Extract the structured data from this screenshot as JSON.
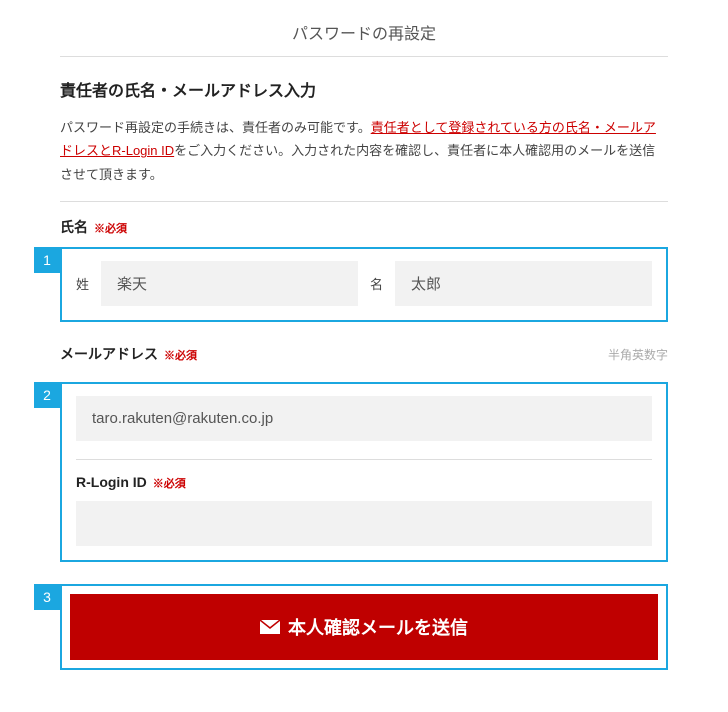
{
  "page": {
    "title": "パスワードの再設定"
  },
  "section": {
    "title": "責任者の氏名・メールアドレス入力",
    "desc_pre": "パスワード再設定の手続きは、責任者のみ可能です。",
    "desc_link": "責任者として登録されている方の氏名・メールアドレスとR-Login ID",
    "desc_post": "をご入力ください。入力された内容を確認し、責任者に本人確認用のメールを送信させて頂きます。"
  },
  "badges": {
    "b1": "1",
    "b2": "2",
    "b3": "3"
  },
  "name_field": {
    "label": "氏名",
    "required": "※必須",
    "sei_label": "姓",
    "sei_value": "楽天",
    "mei_label": "名",
    "mei_value": "太郎"
  },
  "email_field": {
    "label": "メールアドレス",
    "required": "※必須",
    "hint": "半角英数字",
    "value": "taro.rakuten@rakuten.co.jp"
  },
  "rlogin_field": {
    "label": "R-Login ID",
    "required": "※必須",
    "value": ""
  },
  "submit": {
    "label": "本人確認メールを送信"
  }
}
